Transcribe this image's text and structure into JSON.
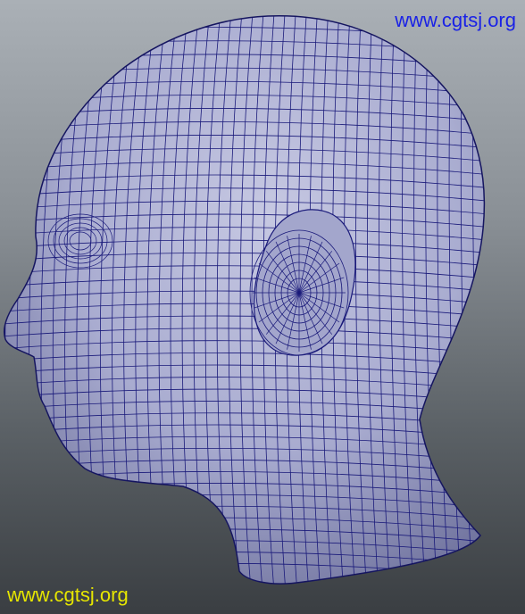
{
  "viewport": {
    "object": "head-mesh",
    "colors": {
      "background_top": "#aab0b6",
      "background_bottom": "#3a3e42",
      "mesh_fill": "#b3b6d4",
      "mesh_fill_shadow": "#6c6f9a",
      "wireframe": "#1a1a7a"
    }
  },
  "watermarks": {
    "top": {
      "text": "www.cgtsj.org",
      "color": "#1a22e6"
    },
    "bottom": {
      "text": "www.cgtsj.org",
      "color": "#e6e600"
    }
  }
}
